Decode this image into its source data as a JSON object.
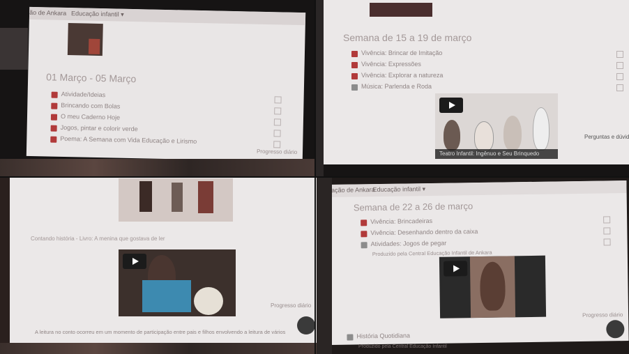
{
  "photos": {
    "top_left": {
      "breadcrumb": "Educação de Ankara",
      "nav_menu": "Educação infantil ▾",
      "week_title": "01 Março - 05 Março",
      "items": [
        {
          "label": "Atividade/Ideias",
          "icon": "folder-icon"
        },
        {
          "label": "Brincando com Bolas",
          "icon": "folder-icon"
        },
        {
          "label": "O meu Caderno Hoje",
          "icon": "folder-icon"
        },
        {
          "label": "Jogos, pintar e colorir verde",
          "icon": "folder-icon"
        },
        {
          "label": "Poema: A Semana com Vida Educação e Lirismo",
          "icon": "folder-icon"
        }
      ],
      "footer": "Progresso diário"
    },
    "top_right": {
      "week_title": "Semana de 15 a 19 de março",
      "items": [
        {
          "label": "Vivência: Brincar de Imitação",
          "icon": "folder-icon"
        },
        {
          "label": "Vivência: Expressões",
          "icon": "folder-icon"
        },
        {
          "label": "Vivência: Explorar a natureza",
          "icon": "folder-icon"
        },
        {
          "label": "Música: Parlenda e Roda",
          "icon": "file-icon"
        }
      ],
      "video_caption": "Teatro Infantil: Ingênuo e Seu Brinquedo",
      "footer": "Perguntas e dúvidas"
    },
    "bottom_left": {
      "breadcrumb": "",
      "link_line": "Contando história - Livro: A menina que gostava de ler",
      "paragraph": "A leitura no conto ocorreu em um momento de participação entre pais e filhos envolvendo a leitura de vários textos, facilitando uma ampla visão para a imaginação da criança que acompanha a ideia do adulto...",
      "footer": "Progresso diário"
    },
    "bottom_right": {
      "breadcrumb": "Educação de Ankara",
      "nav_menu": "Educação infantil ▾",
      "week_title": "Semana de 22 a 26 de março",
      "items": [
        {
          "label": "Vivência: Brincadeiras",
          "icon": "folder-icon"
        },
        {
          "label": "Vivência: Desenhando dentro da caixa",
          "icon": "folder-icon"
        },
        {
          "label": "Atividades: Jogos de pegar",
          "icon": "file-icon"
        }
      ],
      "sub_note": "Produzido pela Central Educação Infantil de Ankara",
      "bottom_item": "História Quotidiana",
      "bottom_note": "Produzido pela Central Educação Infantil",
      "footer": "Progresso diário"
    }
  },
  "colors": {
    "screen": "#e9e6e6",
    "folder_icon": "#b13a3a",
    "bezel": "#161414"
  }
}
